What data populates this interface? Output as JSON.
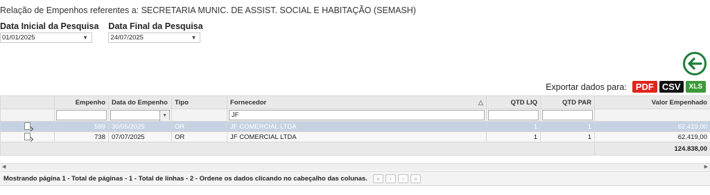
{
  "subtitle": "Relação de Empenhos referentes a: SECRETARIA MUNIC. DE ASSIST. SOCIAL E HABITAÇÃO (SEMASH)",
  "filters": {
    "start_label": "Data Inicial da Pesquisa",
    "start_value": "01/01/2025",
    "end_label": "Data Final da Pesquisa",
    "end_value": "24/07/2025"
  },
  "export": {
    "label": "Exportar dados para:",
    "pdf": "PDF",
    "csv": "CSV",
    "xls": "XLS"
  },
  "table": {
    "columns": {
      "empenho": "Empenho",
      "data": "Data do Empenho",
      "tipo": "Tipo",
      "fornecedor": "Fornecedor",
      "sort_indicator": "△",
      "qtd_liq": "QTD LIQ",
      "qtd_par": "QTD PAR",
      "valor": "Valor Empenhado"
    },
    "filter_fornecedor": "JF",
    "rows": [
      {
        "empenho": "599",
        "data": "30/05/2025",
        "tipo": "OR",
        "fornecedor": "JF COMERCIAL LTDA",
        "qtd_liq": "1",
        "qtd_par": "1",
        "valor": "62.419,00",
        "selected": true
      },
      {
        "empenho": "738",
        "data": "07/07/2025",
        "tipo": "OR",
        "fornecedor": "JF COMERCIAL LTDA",
        "qtd_liq": "1",
        "qtd_par": "1",
        "valor": "62.419,00",
        "selected": false
      }
    ],
    "total_valor": "124.838,00"
  },
  "pager": {
    "text": "Mostrando página 1 - Total de páginas - 1 - Total de linhas - 2 - Ordene os dados clicando no cabeçalho das colunas."
  },
  "colors": {
    "selected_row": "#c5d2e3",
    "back_button": "#1f7c3a",
    "pdf": "#e1251b",
    "csv": "#111111",
    "xls": "#3d9a39"
  },
  "icons": {
    "back": "arrow-left-circle-icon",
    "row": "document-edit-icon"
  }
}
